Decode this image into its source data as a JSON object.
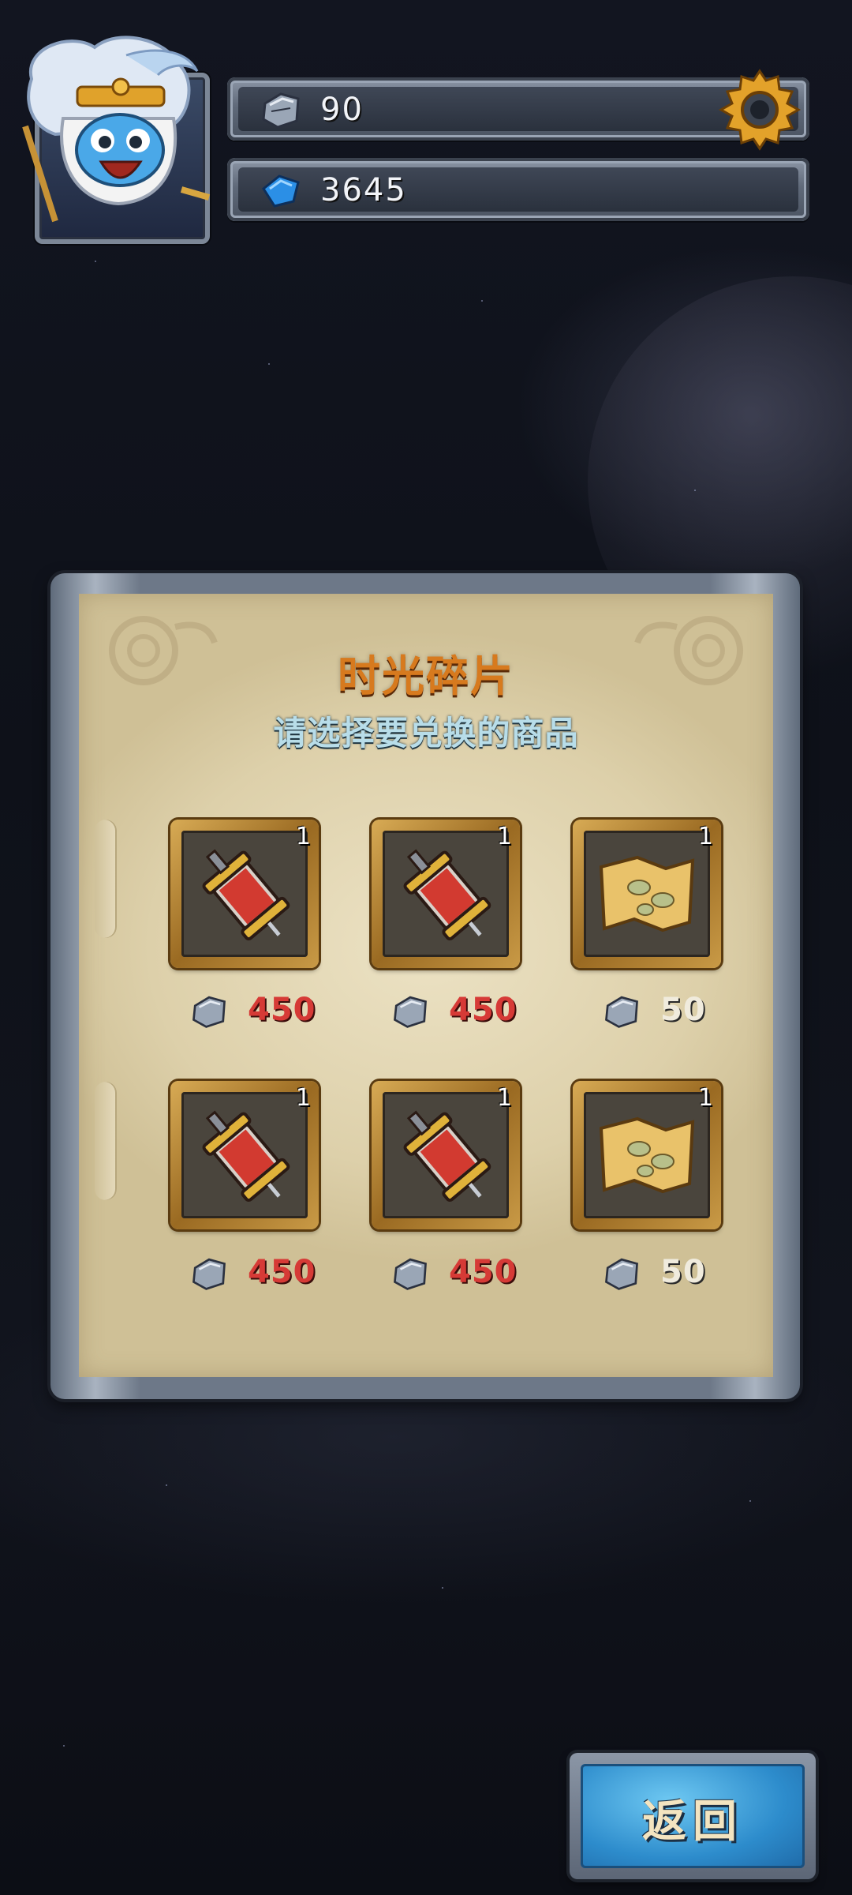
{
  "hud": {
    "time_shards": "90",
    "gems": "3645"
  },
  "shop": {
    "title": "时光碎片",
    "subtitle": "请选择要兑换的商品",
    "items": [
      {
        "icon": "syringe-icon",
        "qty": "1",
        "price": "450",
        "affordable": false
      },
      {
        "icon": "syringe-icon",
        "qty": "1",
        "price": "450",
        "affordable": false
      },
      {
        "icon": "treasure-map-icon",
        "qty": "1",
        "price": "50",
        "affordable": true
      },
      {
        "icon": "syringe-icon",
        "qty": "1",
        "price": "450",
        "affordable": false
      },
      {
        "icon": "syringe-icon",
        "qty": "1",
        "price": "450",
        "affordable": false
      },
      {
        "icon": "treasure-map-icon",
        "qty": "1",
        "price": "50",
        "affordable": true
      }
    ]
  },
  "back_button": {
    "label": "返回"
  },
  "colors": {
    "title": "#d77a1e",
    "subtitle": "#b8dde9",
    "price_unaffordable": "#d63a36",
    "price_affordable": "#f0ebdd",
    "back_button": "#2d8ccc"
  }
}
